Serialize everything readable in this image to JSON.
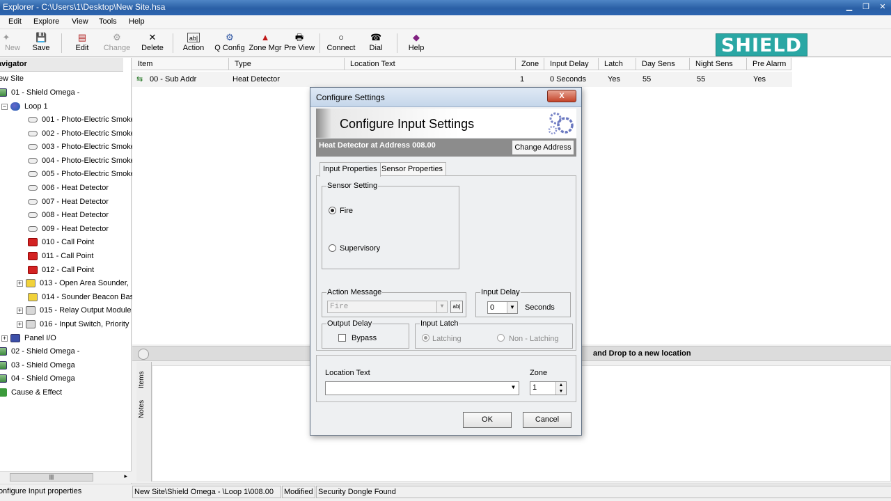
{
  "window": {
    "title": "Explorer - C:\\Users\\1\\Desktop\\New Site.hsa",
    "min": "▁",
    "max": "❐",
    "close": "✕"
  },
  "menu": [
    "Edit",
    "Explore",
    "View",
    "Tools",
    "Help"
  ],
  "toolbar": {
    "new": "New",
    "save": "Save",
    "edit": "Edit",
    "change": "Change",
    "delete": "Delete",
    "action": "Action",
    "qconfig": "Q Config",
    "zonemgr": "Zone Mgr",
    "preview": "Pre View",
    "connect": "Connect",
    "dial": "Dial",
    "help": "Help"
  },
  "brand": {
    "logo_text": "SHIELD",
    "color": "#2aa7a4"
  },
  "navigator": {
    "header": "Navigator",
    "site": "New Site",
    "panel1": "01 - Shield Omega -",
    "loop": "Loop 1",
    "devices": [
      "001 - Photo-Electric Smoke",
      "002 - Photo-Electric Smoke",
      "003 - Photo-Electric Smoke",
      "004 - Photo-Electric Smoke",
      "005 - Photo-Electric Smoke",
      "006 - Heat Detector",
      "007 - Heat Detector",
      "008 - Heat Detector",
      "009 - Heat Detector",
      "010 - Call Point",
      "011 - Call Point",
      "012 - Call Point",
      "013 - Open Area Sounder,",
      "014 - Sounder Beacon Bas",
      "015 - Relay Output Module",
      "016 - Input Switch, Priority"
    ],
    "panel_io": "Panel I/O",
    "panel2": "02 - Shield Omega -",
    "panel3": "03 - Shield Omega",
    "panel4": "04 - Shield Omega",
    "cause_effect": "Cause & Effect"
  },
  "grid": {
    "columns": [
      "Item",
      "Type",
      "Location Text",
      "Zone",
      "Input Delay",
      "Latch",
      "Day Sens",
      "Night Sens",
      "Pre Alarm"
    ],
    "row": {
      "item": "00 - Sub Addr",
      "type": "Heat Detector",
      "location": "",
      "zone": "1",
      "input_delay": "0 Seconds",
      "latch": "Yes",
      "day_sens": "55",
      "night_sens": "55",
      "pre_alarm": "Yes"
    }
  },
  "bottom": {
    "drop_hint": "and Drop to a new location",
    "tab_items": "Items",
    "tab_notes": "Notes"
  },
  "status": {
    "left": "Configure Input properties",
    "path": "New Site\\Shield Omega - \\Loop 1\\008.00",
    "modified": "Modified",
    "dongle": "Security Dongle Found"
  },
  "dialog": {
    "title": "Configure Settings",
    "close": "X",
    "banner": "Configure Input Settings",
    "address_label": "Heat Detector at Address 008.00",
    "change_address": "Change Address",
    "tabs": [
      "Input Properties",
      "Sensor Properties"
    ],
    "sensor_setting": {
      "title": "Sensor Setting",
      "options": [
        "Fire",
        "Supervisory"
      ],
      "selected": "Fire"
    },
    "action_message": {
      "title": "Action Message",
      "value": "Fire",
      "btn": "ab|"
    },
    "input_delay": {
      "title": "Input Delay",
      "value": "0",
      "unit": "Seconds"
    },
    "output_delay": {
      "title": "Output Delay",
      "bypass": "Bypass",
      "bypass_checked": false
    },
    "input_latch": {
      "title": "Input Latch",
      "options": [
        "Latching",
        "Non - Latching"
      ],
      "selected": "Latching"
    },
    "location_text": {
      "label": "Location Text",
      "value": ""
    },
    "zone": {
      "label": "Zone",
      "value": "1"
    },
    "ok": "OK",
    "cancel": "Cancel"
  }
}
